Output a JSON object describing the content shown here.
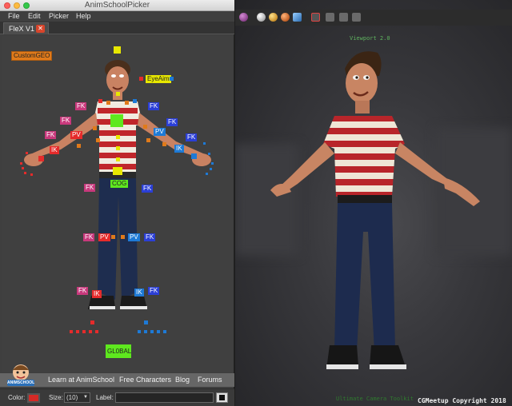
{
  "window": {
    "title": "AnimSchoolPicker"
  },
  "menu": {
    "file": "File",
    "edit": "Edit",
    "picker": "Picker",
    "help": "Help"
  },
  "tab": {
    "label": "FleX V1",
    "close_glyph": "✕"
  },
  "picker": {
    "custom_geo": "CustomGEO",
    "eye_aim": "EyeAim",
    "cog": "COG",
    "global": "GL0BAL",
    "fk": "FK",
    "pv": "PV",
    "ik": "IK"
  },
  "footer": {
    "links": {
      "learn": "Learn at AnimSchool",
      "free": "Free Characters",
      "blog": "Blog",
      "forums": "Forums"
    },
    "logo_text": "ANIMSCHOOL"
  },
  "status": {
    "color_label": "Color:",
    "size_label": "Size:",
    "size_value": "(10)",
    "label_label": "Label:",
    "label_value": ""
  },
  "viewport": {
    "label": "Viewport 2.0",
    "bottom_label": "Ultimate Camera Toolkit",
    "copyright": "CGMeetup Copyright 2018"
  },
  "colors": {
    "right_side": "#e52b2b",
    "left_side": "#1e7ad6",
    "center": "#e8e800",
    "cog": "#5ee81e",
    "orange": "#e07a1a",
    "magenta": "#c8397c",
    "blue_btn": "#2b3fd6"
  }
}
